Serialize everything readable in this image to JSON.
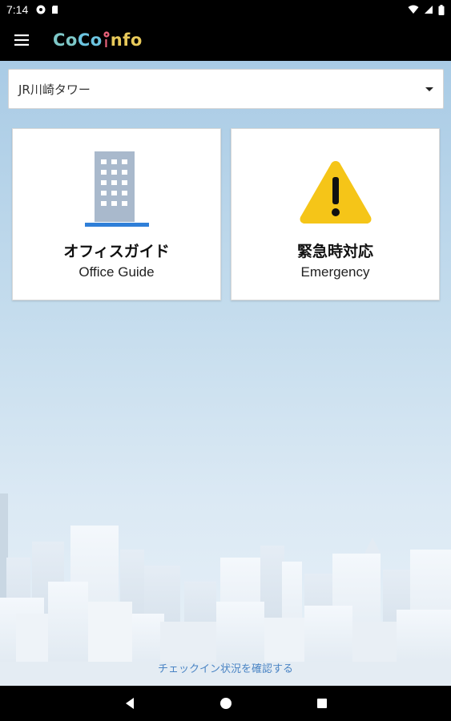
{
  "status_bar": {
    "time": "7:14",
    "icons": [
      "gear-status-icon",
      "sd-card-icon",
      "wifi-icon",
      "signal-icon",
      "battery-icon"
    ]
  },
  "app_bar": {
    "menu_icon": "hamburger-menu-icon",
    "logo_text": [
      "C",
      "o",
      "C",
      "o",
      "I",
      "n",
      "f",
      "o"
    ],
    "logo_colors": [
      "#7ec8c8",
      "#7ec8c8",
      "#6cc4e0",
      "#6cc4e0",
      "#e8627a",
      "#e8c95a",
      "#e8c95a",
      "#e8c95a"
    ]
  },
  "building_selector": {
    "selected": "JR川崎タワー",
    "caret_icon": "dropdown-caret-icon"
  },
  "cards": {
    "office": {
      "icon": "office-building-icon",
      "title_jp": "オフィスガイド",
      "title_en": "Office Guide"
    },
    "emergency": {
      "icon": "warning-triangle-icon",
      "title_jp": "緊急時対応",
      "title_en": "Emergency"
    }
  },
  "footer_link": "チェックイン状況を確認する",
  "nav_bar": {
    "back_icon": "back-triangle-icon",
    "home_icon": "home-circle-icon",
    "recents_icon": "recents-square-icon"
  },
  "colors": {
    "accent_blue": "#2f7fd8",
    "warning_yellow": "#f5c518",
    "sky_top": "#a9cbe5",
    "link_blue": "#4a84c4"
  }
}
